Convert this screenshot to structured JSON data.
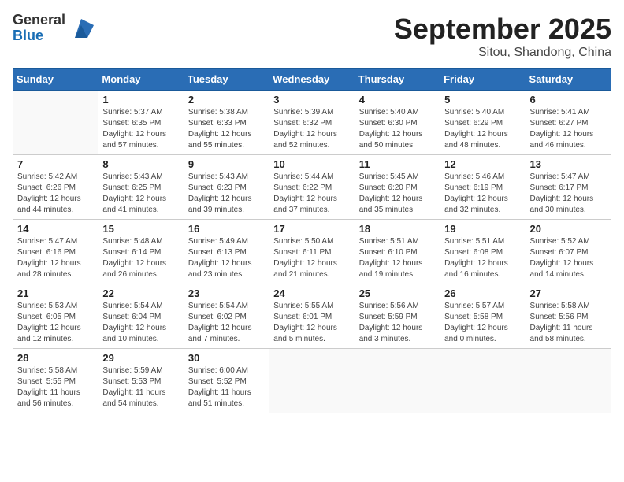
{
  "logo": {
    "general": "General",
    "blue": "Blue"
  },
  "title": "September 2025",
  "location": "Sitou, Shandong, China",
  "days_of_week": [
    "Sunday",
    "Monday",
    "Tuesday",
    "Wednesday",
    "Thursday",
    "Friday",
    "Saturday"
  ],
  "weeks": [
    [
      {
        "day": "",
        "info": ""
      },
      {
        "day": "1",
        "info": "Sunrise: 5:37 AM\nSunset: 6:35 PM\nDaylight: 12 hours\nand 57 minutes."
      },
      {
        "day": "2",
        "info": "Sunrise: 5:38 AM\nSunset: 6:33 PM\nDaylight: 12 hours\nand 55 minutes."
      },
      {
        "day": "3",
        "info": "Sunrise: 5:39 AM\nSunset: 6:32 PM\nDaylight: 12 hours\nand 52 minutes."
      },
      {
        "day": "4",
        "info": "Sunrise: 5:40 AM\nSunset: 6:30 PM\nDaylight: 12 hours\nand 50 minutes."
      },
      {
        "day": "5",
        "info": "Sunrise: 5:40 AM\nSunset: 6:29 PM\nDaylight: 12 hours\nand 48 minutes."
      },
      {
        "day": "6",
        "info": "Sunrise: 5:41 AM\nSunset: 6:27 PM\nDaylight: 12 hours\nand 46 minutes."
      }
    ],
    [
      {
        "day": "7",
        "info": "Sunrise: 5:42 AM\nSunset: 6:26 PM\nDaylight: 12 hours\nand 44 minutes."
      },
      {
        "day": "8",
        "info": "Sunrise: 5:43 AM\nSunset: 6:25 PM\nDaylight: 12 hours\nand 41 minutes."
      },
      {
        "day": "9",
        "info": "Sunrise: 5:43 AM\nSunset: 6:23 PM\nDaylight: 12 hours\nand 39 minutes."
      },
      {
        "day": "10",
        "info": "Sunrise: 5:44 AM\nSunset: 6:22 PM\nDaylight: 12 hours\nand 37 minutes."
      },
      {
        "day": "11",
        "info": "Sunrise: 5:45 AM\nSunset: 6:20 PM\nDaylight: 12 hours\nand 35 minutes."
      },
      {
        "day": "12",
        "info": "Sunrise: 5:46 AM\nSunset: 6:19 PM\nDaylight: 12 hours\nand 32 minutes."
      },
      {
        "day": "13",
        "info": "Sunrise: 5:47 AM\nSunset: 6:17 PM\nDaylight: 12 hours\nand 30 minutes."
      }
    ],
    [
      {
        "day": "14",
        "info": "Sunrise: 5:47 AM\nSunset: 6:16 PM\nDaylight: 12 hours\nand 28 minutes."
      },
      {
        "day": "15",
        "info": "Sunrise: 5:48 AM\nSunset: 6:14 PM\nDaylight: 12 hours\nand 26 minutes."
      },
      {
        "day": "16",
        "info": "Sunrise: 5:49 AM\nSunset: 6:13 PM\nDaylight: 12 hours\nand 23 minutes."
      },
      {
        "day": "17",
        "info": "Sunrise: 5:50 AM\nSunset: 6:11 PM\nDaylight: 12 hours\nand 21 minutes."
      },
      {
        "day": "18",
        "info": "Sunrise: 5:51 AM\nSunset: 6:10 PM\nDaylight: 12 hours\nand 19 minutes."
      },
      {
        "day": "19",
        "info": "Sunrise: 5:51 AM\nSunset: 6:08 PM\nDaylight: 12 hours\nand 16 minutes."
      },
      {
        "day": "20",
        "info": "Sunrise: 5:52 AM\nSunset: 6:07 PM\nDaylight: 12 hours\nand 14 minutes."
      }
    ],
    [
      {
        "day": "21",
        "info": "Sunrise: 5:53 AM\nSunset: 6:05 PM\nDaylight: 12 hours\nand 12 minutes."
      },
      {
        "day": "22",
        "info": "Sunrise: 5:54 AM\nSunset: 6:04 PM\nDaylight: 12 hours\nand 10 minutes."
      },
      {
        "day": "23",
        "info": "Sunrise: 5:54 AM\nSunset: 6:02 PM\nDaylight: 12 hours\nand 7 minutes."
      },
      {
        "day": "24",
        "info": "Sunrise: 5:55 AM\nSunset: 6:01 PM\nDaylight: 12 hours\nand 5 minutes."
      },
      {
        "day": "25",
        "info": "Sunrise: 5:56 AM\nSunset: 5:59 PM\nDaylight: 12 hours\nand 3 minutes."
      },
      {
        "day": "26",
        "info": "Sunrise: 5:57 AM\nSunset: 5:58 PM\nDaylight: 12 hours\nand 0 minutes."
      },
      {
        "day": "27",
        "info": "Sunrise: 5:58 AM\nSunset: 5:56 PM\nDaylight: 11 hours\nand 58 minutes."
      }
    ],
    [
      {
        "day": "28",
        "info": "Sunrise: 5:58 AM\nSunset: 5:55 PM\nDaylight: 11 hours\nand 56 minutes."
      },
      {
        "day": "29",
        "info": "Sunrise: 5:59 AM\nSunset: 5:53 PM\nDaylight: 11 hours\nand 54 minutes."
      },
      {
        "day": "30",
        "info": "Sunrise: 6:00 AM\nSunset: 5:52 PM\nDaylight: 11 hours\nand 51 minutes."
      },
      {
        "day": "",
        "info": ""
      },
      {
        "day": "",
        "info": ""
      },
      {
        "day": "",
        "info": ""
      },
      {
        "day": "",
        "info": ""
      }
    ]
  ]
}
